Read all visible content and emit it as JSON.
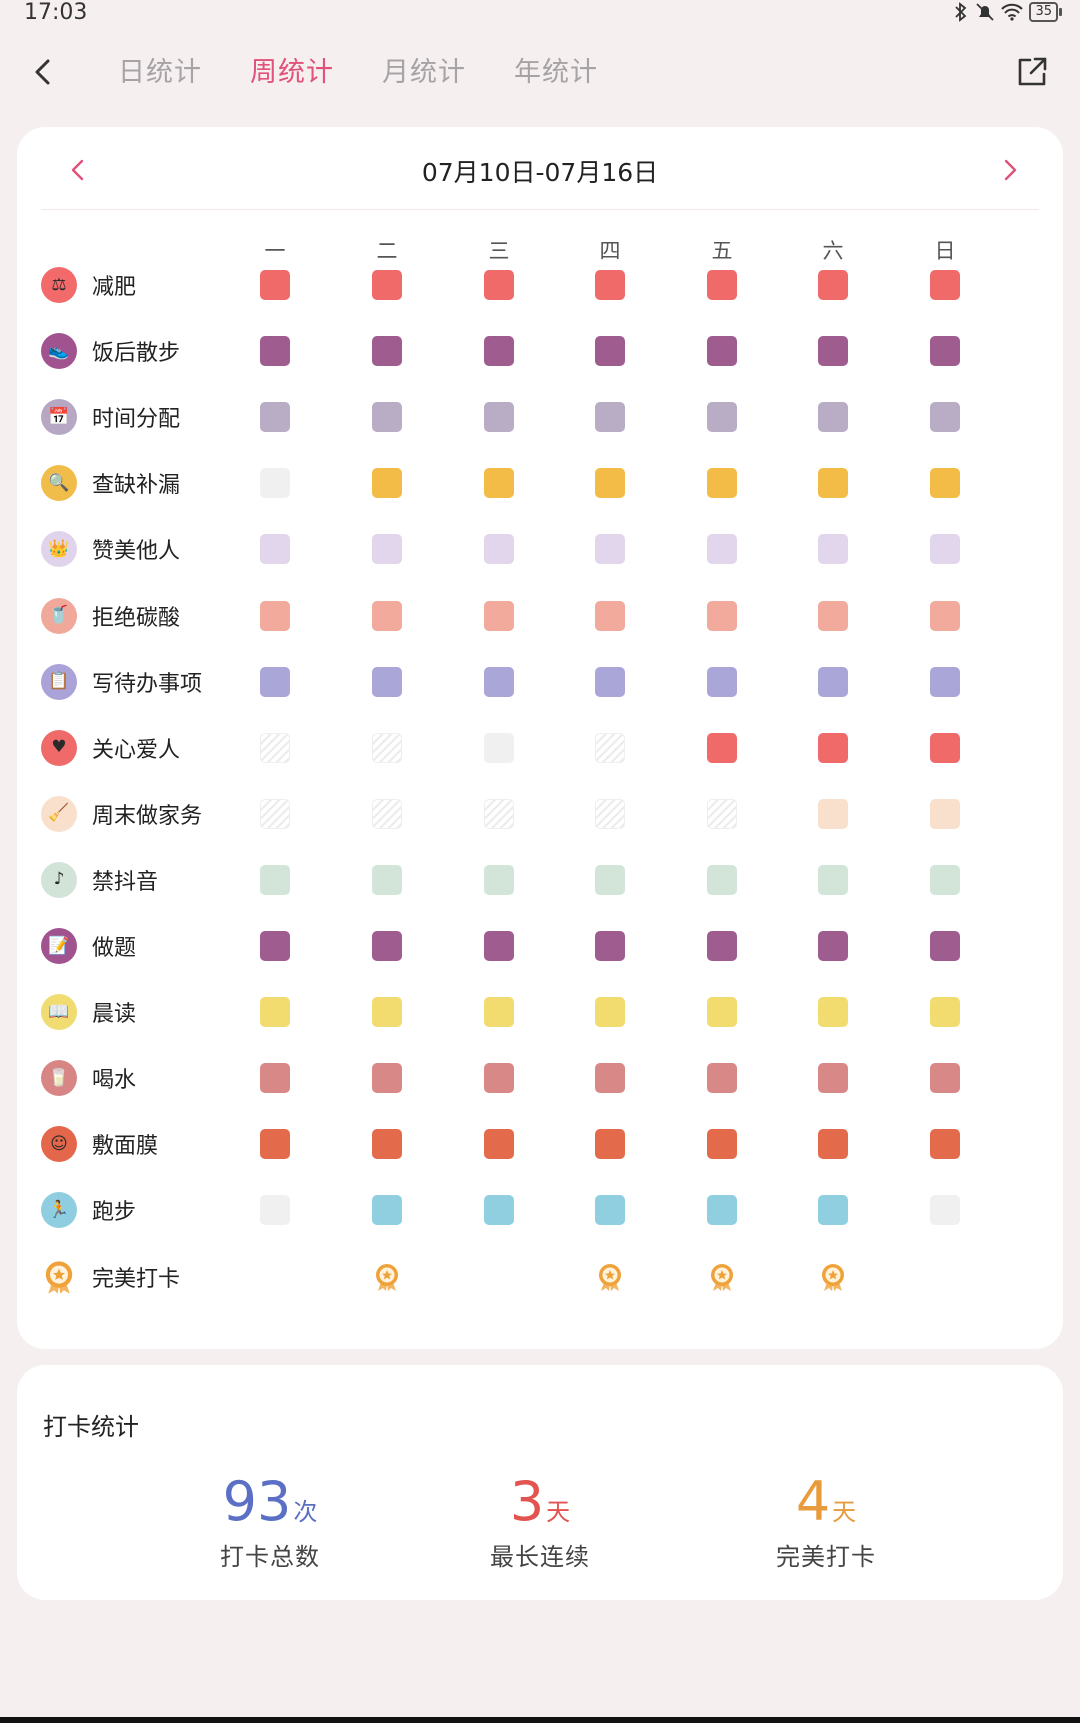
{
  "status": {
    "time": "17:03",
    "battery": "35"
  },
  "tabs": [
    {
      "label": "日统计",
      "active": false
    },
    {
      "label": "周统计",
      "active": true
    },
    {
      "label": "月统计",
      "active": false
    },
    {
      "label": "年统计",
      "active": false
    }
  ],
  "week_range": "07月10日-07月16日",
  "days": [
    "一",
    "二",
    "三",
    "四",
    "五",
    "六",
    "日"
  ],
  "habits": [
    {
      "name": "减肥",
      "icon": "scale-icon",
      "glyph": "⚖",
      "icon_bg": "#f26a6a",
      "color": "#f06a6a",
      "days": [
        "done",
        "done",
        "done",
        "done",
        "done",
        "done",
        "done"
      ]
    },
    {
      "name": "饭后散步",
      "icon": "shoe-icon",
      "glyph": "👟",
      "icon_bg": "#a0538f",
      "color": "#9e5c8f",
      "days": [
        "done",
        "done",
        "done",
        "done",
        "done",
        "done",
        "done"
      ]
    },
    {
      "name": "时间分配",
      "icon": "calendar-icon",
      "glyph": "📅",
      "icon_bg": "#b6a7c5",
      "color": "#b9adc6",
      "days": [
        "done",
        "done",
        "done",
        "done",
        "done",
        "done",
        "done"
      ]
    },
    {
      "name": "查缺补漏",
      "icon": "magnifier-icon",
      "glyph": "🔍",
      "icon_bg": "#f1bd4a",
      "color": "#f3bc46",
      "days": [
        "empty",
        "done",
        "done",
        "done",
        "done",
        "done",
        "done"
      ]
    },
    {
      "name": "赞美他人",
      "icon": "crown-icon",
      "glyph": "👑",
      "icon_bg": "#e0d3ec",
      "color": "#e1d6ec",
      "days": [
        "done",
        "done",
        "done",
        "done",
        "done",
        "done",
        "done"
      ]
    },
    {
      "name": "拒绝碳酸",
      "icon": "soda-cup-icon",
      "glyph": "🥤",
      "icon_bg": "#f0a89a",
      "color": "#f1aa9c",
      "days": [
        "done",
        "done",
        "done",
        "done",
        "done",
        "done",
        "done"
      ]
    },
    {
      "name": "写待办事项",
      "icon": "notepad-icon",
      "glyph": "📋",
      "icon_bg": "#a9a3d8",
      "color": "#aba6d8",
      "days": [
        "done",
        "done",
        "done",
        "done",
        "done",
        "done",
        "done"
      ]
    },
    {
      "name": "关心爱人",
      "icon": "heart-icon",
      "glyph": "♥",
      "icon_bg": "#f06a6a",
      "color": "#f06a6a",
      "days": [
        "inactive",
        "inactive",
        "empty",
        "inactive",
        "done",
        "done",
        "done"
      ]
    },
    {
      "name": "周末做家务",
      "icon": "broom-icon",
      "glyph": "🧹",
      "icon_bg": "#f9e0cd",
      "color": "#f9e0cc",
      "days": [
        "inactive",
        "inactive",
        "inactive",
        "inactive",
        "inactive",
        "done",
        "done"
      ]
    },
    {
      "name": "禁抖音",
      "icon": "tiktok-icon",
      "glyph": "♪",
      "icon_bg": "#d2e3d8",
      "color": "#d3e4d9",
      "days": [
        "done",
        "done",
        "done",
        "done",
        "done",
        "done",
        "done"
      ]
    },
    {
      "name": "做题",
      "icon": "worksheet-icon",
      "glyph": "📝",
      "icon_bg": "#a0538f",
      "color": "#9e5c8f",
      "days": [
        "done",
        "done",
        "done",
        "done",
        "done",
        "done",
        "done"
      ]
    },
    {
      "name": "晨读",
      "icon": "book-icon",
      "glyph": "📖",
      "icon_bg": "#f1dc72",
      "color": "#f2dc70",
      "days": [
        "done",
        "done",
        "done",
        "done",
        "done",
        "done",
        "done"
      ]
    },
    {
      "name": "喝水",
      "icon": "water-cup-icon",
      "glyph": "🥛",
      "icon_bg": "#d88685",
      "color": "#d98888",
      "days": [
        "done",
        "done",
        "done",
        "done",
        "done",
        "done",
        "done"
      ]
    },
    {
      "name": "敷面膜",
      "icon": "face-mask-icon",
      "glyph": "☺",
      "icon_bg": "#e4664b",
      "color": "#e36a4b",
      "days": [
        "done",
        "done",
        "done",
        "done",
        "done",
        "done",
        "done"
      ]
    },
    {
      "name": "跑步",
      "icon": "runner-icon",
      "glyph": "🏃",
      "icon_bg": "#8fcee0",
      "color": "#90cfe0",
      "days": [
        "empty",
        "done",
        "done",
        "done",
        "done",
        "done",
        "empty"
      ]
    },
    {
      "name": "完美打卡",
      "icon": "medal-icon",
      "glyph": "",
      "icon_bg": "#ffffff",
      "color": "#f0a23a",
      "days": [
        "none",
        "badge",
        "none",
        "badge",
        "badge",
        "badge",
        "none"
      ]
    }
  ],
  "colors": {
    "accent": "#e0527a",
    "empty_cell": "#f0f0f0",
    "medal": "#f0a23a",
    "stat_total": "#5b6fc4",
    "stat_streak": "#e3534f",
    "stat_perfect": "#e79b3c"
  },
  "stats": {
    "title": "打卡统计",
    "items": [
      {
        "value": "93",
        "unit": "次",
        "label": "打卡总数",
        "color": "#5b6fc4"
      },
      {
        "value": "3",
        "unit": "天",
        "label": "最长连续",
        "color": "#e3534f"
      },
      {
        "value": "4",
        "unit": "天",
        "label": "完美打卡",
        "color": "#e79b3c"
      }
    ]
  }
}
